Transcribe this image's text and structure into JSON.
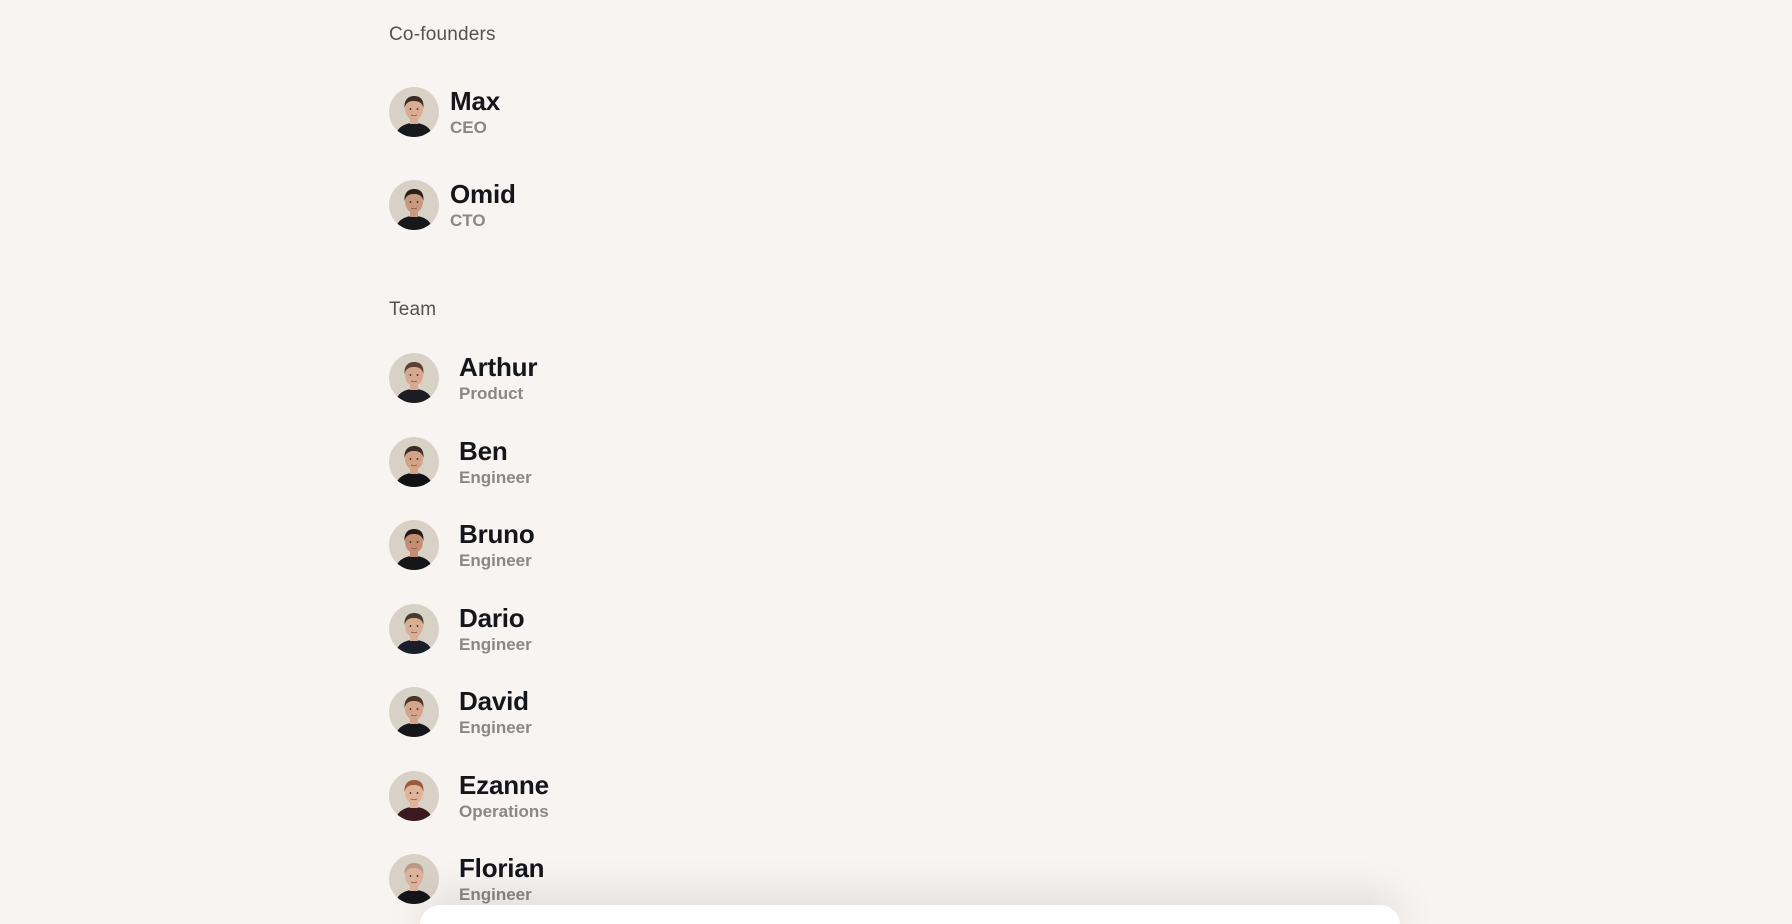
{
  "sections": {
    "cofounders": {
      "heading": "Co-founders",
      "people": [
        {
          "name": "Max",
          "role": "CEO",
          "skin": "#d9ad93",
          "hair": "#3a2c25",
          "shirt": "#17181c"
        },
        {
          "name": "Omid",
          "role": "CTO",
          "skin": "#c79a80",
          "hair": "#2a211d",
          "shirt": "#17181c"
        }
      ]
    },
    "team": {
      "heading": "Team",
      "people": [
        {
          "name": "Arthur",
          "role": "Product",
          "skin": "#d6a88d",
          "hair": "#5a4131",
          "shirt": "#1c1d22"
        },
        {
          "name": "Ben",
          "role": "Engineer",
          "skin": "#d3a386",
          "hair": "#3c2d24",
          "shirt": "#111215"
        },
        {
          "name": "Bruno",
          "role": "Engineer",
          "skin": "#c48e73",
          "hair": "#241b17",
          "shirt": "#15161a"
        },
        {
          "name": "Dario",
          "role": "Engineer",
          "skin": "#d8ae95",
          "hair": "#4a3a30",
          "shirt": "#1a1e2a"
        },
        {
          "name": "David",
          "role": "Engineer",
          "skin": "#d4a58b",
          "hair": "#4b3527",
          "shirt": "#151619"
        },
        {
          "name": "Ezanne",
          "role": "Operations",
          "skin": "#e0b49a",
          "hair": "#9b5a39",
          "shirt": "#3a1a1e"
        },
        {
          "name": "Florian",
          "role": "Engineer",
          "skin": "#dcb39d",
          "hair": "#b79a88",
          "shirt": "#141518"
        }
      ]
    }
  }
}
